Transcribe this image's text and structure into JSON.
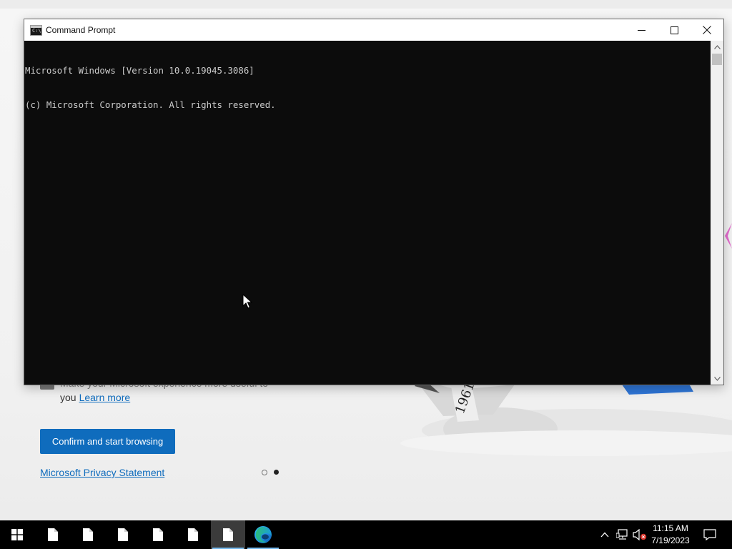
{
  "background_page": {
    "consent_text_line1": "Make your Microsoft experience more useful to",
    "consent_text_line2": "you",
    "learn_more_link": "Learn more",
    "confirm_button": "Confirm and start browsing",
    "privacy_link": "Microsoft Privacy Statement",
    "carousel": {
      "total": 2,
      "active": 2
    },
    "colors": {
      "accent": "#0f6cbd"
    }
  },
  "cmd_window": {
    "title": "Command Prompt",
    "app_icon": "cmd-icon",
    "controls": {
      "minimize": "minimize-icon",
      "maximize": "maximize-icon",
      "close": "close-icon"
    },
    "console_lines": [
      "Microsoft Windows [Version 10.0.19045.3086]",
      "(c) Microsoft Corporation. All rights reserved."
    ],
    "colors": {
      "console_bg": "#0c0c0c",
      "console_fg": "#cccccc"
    }
  },
  "taskbar": {
    "start_icon": "windows-start-icon",
    "pinned": [
      {
        "icon": "document-icon",
        "active": false
      },
      {
        "icon": "document-icon",
        "active": false
      },
      {
        "icon": "document-icon",
        "active": false
      },
      {
        "icon": "document-icon",
        "active": false
      },
      {
        "icon": "document-icon",
        "active": false
      },
      {
        "icon": "document-icon",
        "active": true
      },
      {
        "icon": "edge-icon",
        "active": false
      }
    ],
    "tray": {
      "chevron": "chevron-up-icon",
      "network": "network-icon",
      "volume": "volume-muted-icon",
      "notifications": "action-center-icon"
    },
    "clock": {
      "time": "11:15 AM",
      "date": "7/19/2023"
    }
  }
}
